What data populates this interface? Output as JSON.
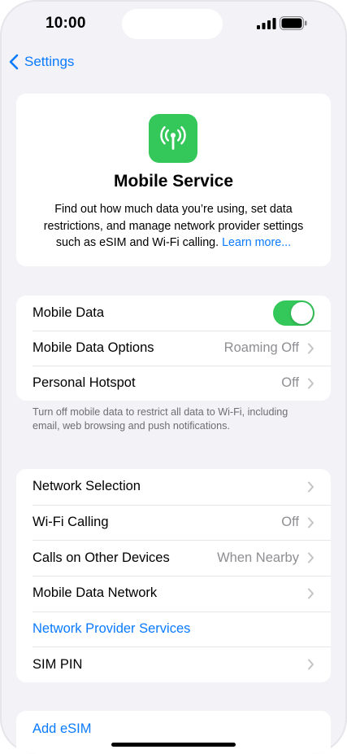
{
  "status_bar": {
    "time": "10:00"
  },
  "nav": {
    "back_label": "Settings"
  },
  "hero": {
    "title": "Mobile Service",
    "description": "Find out how much data you’re using, set data restrictions, and manage network provider settings such as eSIM and Wi-Fi calling.",
    "link_label": "Learn more...",
    "icon": "antenna-radiowaves-icon",
    "icon_color": "#34c759"
  },
  "group1": {
    "rows": [
      {
        "label": "Mobile Data",
        "toggle_on": true
      },
      {
        "label": "Mobile Data Options",
        "value": "Roaming Off"
      },
      {
        "label": "Personal Hotspot",
        "value": "Off"
      }
    ],
    "footnote": "Turn off mobile data to restrict all data to Wi-Fi, including email, web browsing and push notifications."
  },
  "group2": {
    "rows": [
      {
        "label": "Network Selection",
        "value": ""
      },
      {
        "label": "Wi-Fi Calling",
        "value": "Off"
      },
      {
        "label": "Calls on Other Devices",
        "value": "When Nearby"
      },
      {
        "label": "Mobile Data Network",
        "value": ""
      },
      {
        "label": "Network Provider Services"
      },
      {
        "label": "SIM PIN",
        "value": ""
      }
    ]
  },
  "group3": {
    "rows": [
      {
        "label": "Add eSIM"
      }
    ]
  },
  "colors": {
    "accent": "#0a7aff",
    "toggle_on": "#34c759",
    "background": "#f2f2f7"
  }
}
